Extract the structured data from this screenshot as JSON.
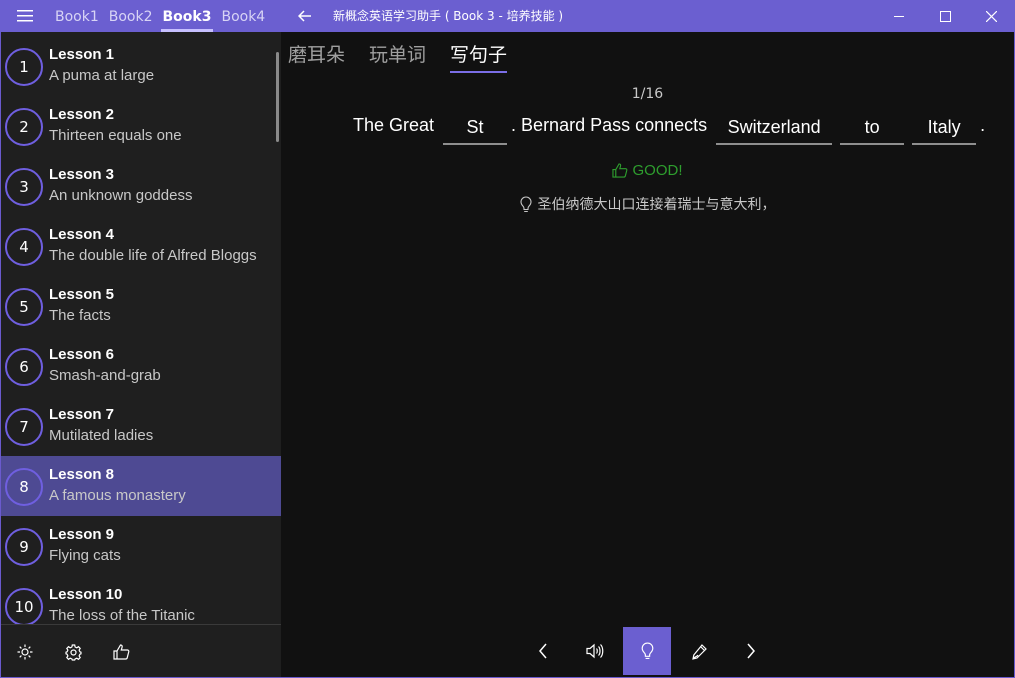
{
  "titlebar": {
    "books": [
      {
        "label": "Book1",
        "active": false
      },
      {
        "label": "Book2",
        "active": false
      },
      {
        "label": "Book3",
        "active": true
      },
      {
        "label": "Book4",
        "active": false
      }
    ],
    "app_title": "新概念英语学习助手 ( Book 3 - 培养技能 )"
  },
  "sidebar": {
    "lessons": [
      {
        "num": "1",
        "title": "Lesson 1",
        "subtitle": "A puma at large"
      },
      {
        "num": "2",
        "title": "Lesson 2",
        "subtitle": "Thirteen equals one"
      },
      {
        "num": "3",
        "title": "Lesson 3",
        "subtitle": "An unknown goddess"
      },
      {
        "num": "4",
        "title": "Lesson 4",
        "subtitle": "The double life of Alfred Bloggs"
      },
      {
        "num": "5",
        "title": "Lesson 5",
        "subtitle": "The facts"
      },
      {
        "num": "6",
        "title": "Lesson 6",
        "subtitle": "Smash-and-grab"
      },
      {
        "num": "7",
        "title": "Lesson 7",
        "subtitle": "Mutilated ladies"
      },
      {
        "num": "8",
        "title": "Lesson 8",
        "subtitle": "A famous monastery",
        "selected": true
      },
      {
        "num": "9",
        "title": "Lesson 9",
        "subtitle": "Flying cats"
      },
      {
        "num": "10",
        "title": "Lesson 10",
        "subtitle": "The loss of the Titanic"
      }
    ],
    "footer_icons": [
      "brightness-icon",
      "gear-icon",
      "thumbs-up-icon"
    ]
  },
  "main": {
    "tabs": [
      {
        "label": "磨耳朵",
        "active": false
      },
      {
        "label": "玩单词",
        "active": false
      },
      {
        "label": "写句子",
        "active": true
      }
    ],
    "progress": "1/16",
    "sentence": [
      {
        "type": "text",
        "value": "The Great "
      },
      {
        "type": "blank",
        "value": "St"
      },
      {
        "type": "text",
        "value": ". Bernard Pass connects "
      },
      {
        "type": "blank",
        "value": "Switzerland"
      },
      {
        "type": "blank",
        "value": "to"
      },
      {
        "type": "blank",
        "value": "Italy"
      },
      {
        "type": "text",
        "value": "."
      }
    ],
    "feedback": "GOOD!",
    "hint": "圣伯纳德大山口连接着瑞士与意大利，",
    "controls": [
      "prev-icon",
      "speaker-icon",
      "lightbulb-icon",
      "pen-icon",
      "next-icon"
    ],
    "active_control": "lightbulb-icon"
  },
  "colors": {
    "accent": "#6b5fd0",
    "selected_row": "#4e4a93",
    "success": "#2e9e2e",
    "main_bg": "#111111",
    "sidebar_bg": "#1f1f1f"
  }
}
